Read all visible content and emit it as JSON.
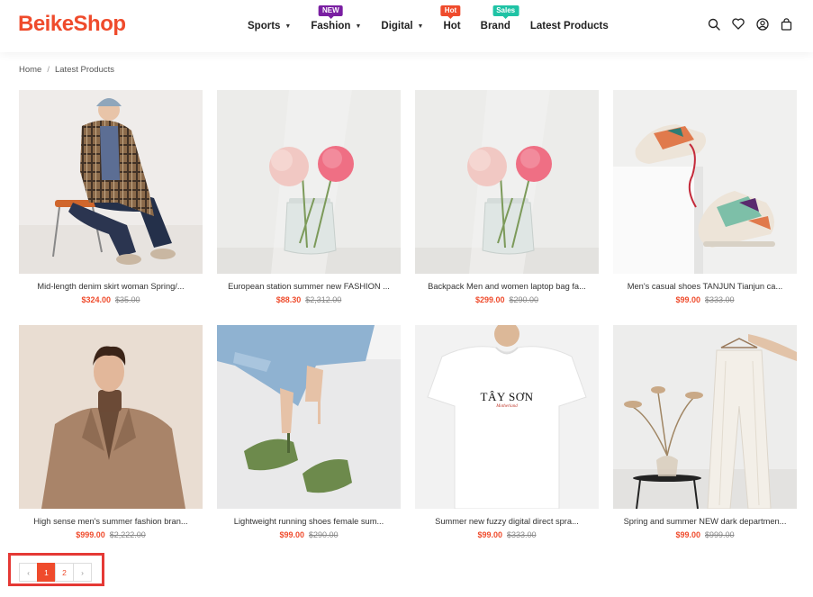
{
  "brand": {
    "logo_text": "BeikeShop",
    "accent": "#ef4b2c"
  },
  "nav": [
    {
      "label": "Sports",
      "caret": true,
      "badge": ""
    },
    {
      "label": "Fashion",
      "caret": true,
      "badge": "NEW"
    },
    {
      "label": "Digital",
      "caret": true,
      "badge": ""
    },
    {
      "label": "Hot",
      "caret": false,
      "badge": "Hot"
    },
    {
      "label": "Brand",
      "caret": false,
      "badge": "Sales"
    },
    {
      "label": "Latest Products",
      "caret": false,
      "badge": ""
    }
  ],
  "header_icons": [
    "search-icon",
    "heart-icon",
    "user-icon",
    "cart-icon"
  ],
  "breadcrumb": {
    "home": "Home",
    "separator": "/",
    "current": "Latest Products"
  },
  "products": [
    {
      "name": "Mid-length denim skirt woman Spring/...",
      "price": "$324.00",
      "old_price": "$35.00",
      "image": "woman-in-plaid-coat"
    },
    {
      "name": "European station summer new FASHION ...",
      "price": "$88.30",
      "old_price": "$2,312.00",
      "image": "flowers-in-vase"
    },
    {
      "name": "Backpack Men and women laptop bag fa...",
      "price": "$299.00",
      "old_price": "$290.00",
      "image": "flowers-in-vase"
    },
    {
      "name": "Men's casual shoes TANJUN Tianjun ca...",
      "price": "$99.00",
      "old_price": "$333.00",
      "image": "sneakers"
    },
    {
      "name": "High sense men's summer fashion bran...",
      "price": "$999.00",
      "old_price": "$2,222.00",
      "image": "man-in-coat"
    },
    {
      "name": "Lightweight running shoes female sum...",
      "price": "$99.00",
      "old_price": "$290.00",
      "image": "green-sandals"
    },
    {
      "name": "Summer new fuzzy digital direct spra...",
      "price": "$99.00",
      "old_price": "$333.00",
      "image": "white-tshirt",
      "print_text": "TÂY SƠN",
      "print_sub": "Motherland"
    },
    {
      "name": "Spring and summer NEW dark departmen...",
      "price": "$99.00",
      "old_price": "$999.00",
      "image": "white-trousers"
    }
  ],
  "pagination": {
    "prev": "‹",
    "pages": [
      "1",
      "2"
    ],
    "current": "1",
    "next": "›"
  }
}
